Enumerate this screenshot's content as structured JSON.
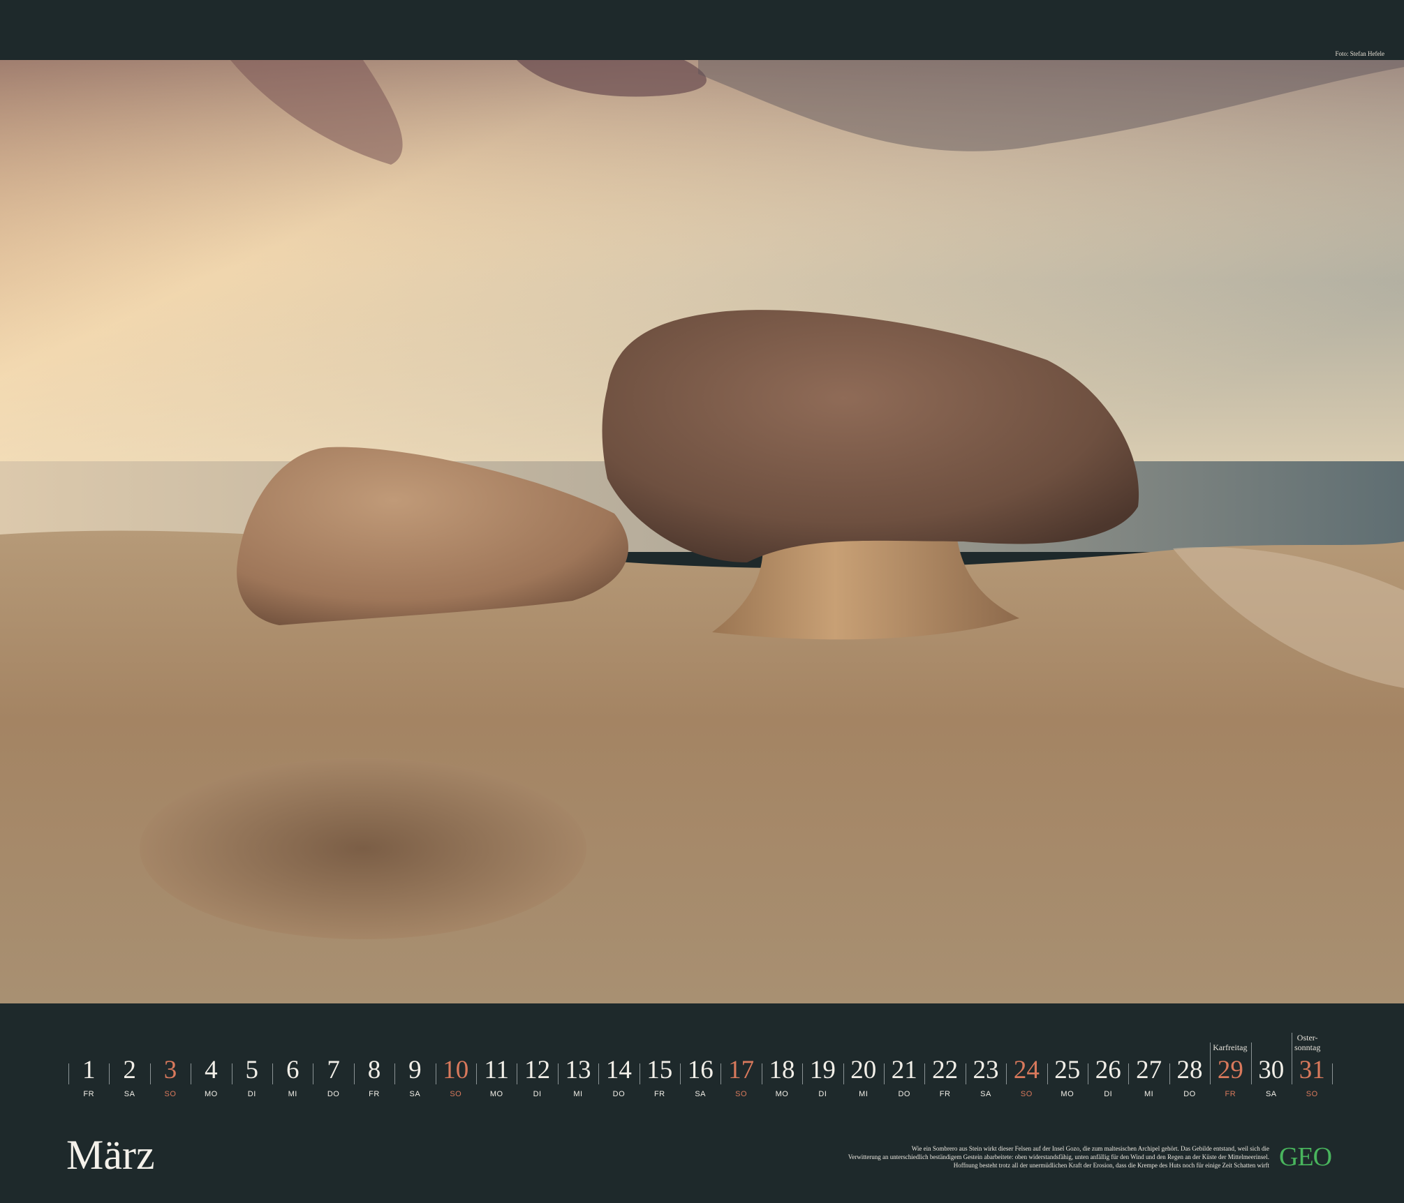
{
  "photo_credit": "Foto: Stefan Hefele",
  "month": "März",
  "logo": "GEO",
  "caption_lines": [
    "Wie ein Sombrero aus Stein wirkt dieser Felsen auf der Insel Gozo, die zum maltesischen Archipel gehört. Das Gebilde entstand, weil sich die",
    "Verwitterung an unterschiedlich beständigem Gestein abarbeitete: oben widerstandsfähig, unten anfällig für den Wind und den Regen an der Küste der Mittelmeerinsel.",
    "Hoffnung besteht trotz all der unermüdlichen Kraft der Erosion, dass die Krempe des Huts noch für einige Zeit Schatten wirft"
  ],
  "colors": {
    "background": "#1e292b",
    "holiday": "#d9795c",
    "logo": "#49b55d"
  },
  "days": [
    {
      "n": "1",
      "wd": "FR",
      "h": false
    },
    {
      "n": "2",
      "wd": "SA",
      "h": false
    },
    {
      "n": "3",
      "wd": "SO",
      "h": true
    },
    {
      "n": "4",
      "wd": "MO",
      "h": false
    },
    {
      "n": "5",
      "wd": "DI",
      "h": false
    },
    {
      "n": "6",
      "wd": "MI",
      "h": false
    },
    {
      "n": "7",
      "wd": "DO",
      "h": false
    },
    {
      "n": "8",
      "wd": "FR",
      "h": false
    },
    {
      "n": "9",
      "wd": "SA",
      "h": false
    },
    {
      "n": "10",
      "wd": "SO",
      "h": true
    },
    {
      "n": "11",
      "wd": "MO",
      "h": false
    },
    {
      "n": "12",
      "wd": "DI",
      "h": false
    },
    {
      "n": "13",
      "wd": "MI",
      "h": false
    },
    {
      "n": "14",
      "wd": "DO",
      "h": false
    },
    {
      "n": "15",
      "wd": "FR",
      "h": false
    },
    {
      "n": "16",
      "wd": "SA",
      "h": false
    },
    {
      "n": "17",
      "wd": "SO",
      "h": true
    },
    {
      "n": "18",
      "wd": "MO",
      "h": false
    },
    {
      "n": "19",
      "wd": "DI",
      "h": false
    },
    {
      "n": "20",
      "wd": "MI",
      "h": false
    },
    {
      "n": "21",
      "wd": "DO",
      "h": false
    },
    {
      "n": "22",
      "wd": "FR",
      "h": false
    },
    {
      "n": "23",
      "wd": "SA",
      "h": false
    },
    {
      "n": "24",
      "wd": "SO",
      "h": true
    },
    {
      "n": "25",
      "wd": "MO",
      "h": false
    },
    {
      "n": "26",
      "wd": "DI",
      "h": false
    },
    {
      "n": "27",
      "wd": "MI",
      "h": false
    },
    {
      "n": "28",
      "wd": "DO",
      "h": false
    },
    {
      "n": "29",
      "wd": "FR",
      "h": true,
      "label": "Karfreitag"
    },
    {
      "n": "30",
      "wd": "SA",
      "h": false
    },
    {
      "n": "31",
      "wd": "SO",
      "h": true,
      "label_lines": [
        "Oster-",
        "sonntag"
      ]
    }
  ]
}
